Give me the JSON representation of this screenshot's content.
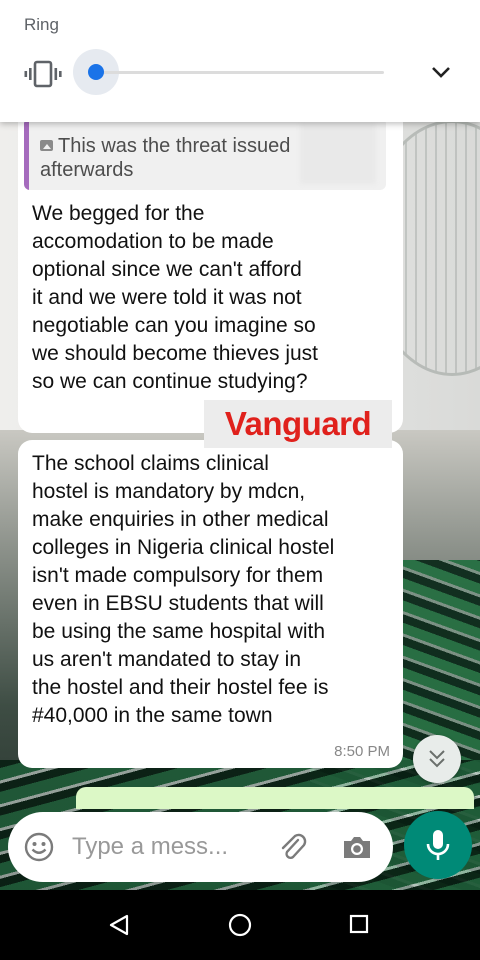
{
  "volume_panel": {
    "title": "Ring",
    "mode_icon": "vibrate-icon",
    "volume_fraction": 0.0,
    "expand_icon": "chevron-down-icon"
  },
  "chat": {
    "messages": [
      {
        "quoted_label": "This was the threat issued afterwards",
        "quoted_icon": "photo-icon",
        "quote_color": "#a56bbd",
        "text": "We begged for the\naccomodation to be made\noptional since we can't afford\nit and we were told it was not\nnegotiable can you imagine so\nwe should become thieves just\nso we can continue studying?"
      },
      {
        "text": "The school claims clinical\nhostel is mandatory by mdcn,\nmake enquiries in other medical\ncolleges in Nigeria clinical hostel\nisn't made compulsory for them\neven in EBSU students that will\nbe using the same hospital with\nus aren't mandated to stay in\nthe hostel and their hostel fee is\n#40,000 in the same town",
        "time": "8:50 PM"
      }
    ],
    "watermark": "Vanguard",
    "watermark_color": "#e0211c",
    "scroll_down_icon": "double-chevron-down-icon"
  },
  "composer": {
    "placeholder": "Type a mess...",
    "emoji_icon": "emoji-icon",
    "attach_icon": "paperclip-icon",
    "camera_icon": "camera-icon",
    "mic_icon": "mic-icon",
    "accent": "#008a77"
  },
  "navigation": {
    "back_icon": "back-triangle-icon",
    "home_icon": "home-circle-icon",
    "recents_icon": "recents-square-icon"
  }
}
